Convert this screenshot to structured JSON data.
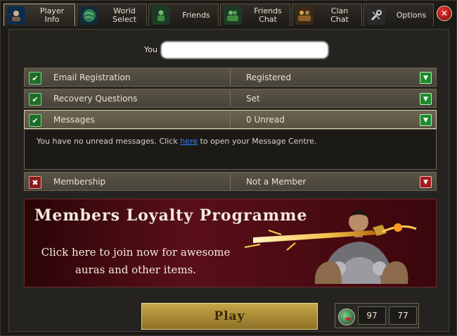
{
  "tabs": [
    {
      "label": "Player\nInfo",
      "icon": "player-icon"
    },
    {
      "label": "World\nSelect",
      "icon": "globe-icon"
    },
    {
      "label": "Friends",
      "icon": "friends-icon"
    },
    {
      "label": "Friends\nChat",
      "icon": "friends-chat-icon"
    },
    {
      "label": "Clan\nChat",
      "icon": "clan-icon"
    },
    {
      "label": "Options",
      "icon": "wrench-icon"
    }
  ],
  "you_label": "You",
  "rows": [
    {
      "name": "Email Registration",
      "value": "Registered",
      "status": "ok"
    },
    {
      "name": "Recovery Questions",
      "value": "Set",
      "status": "ok"
    },
    {
      "name": "Messages",
      "value": "0 Unread",
      "status": "ok"
    },
    {
      "name": "Membership",
      "value": "Not a Member",
      "status": "bad"
    }
  ],
  "message_info": {
    "prefix": "You have no unread messages. Click ",
    "link": "here",
    "suffix": " to open your Message Centre."
  },
  "banner": {
    "title": "Members Loyalty Programme",
    "line1": "Click here to join now for awesome",
    "line2": "auras and other items."
  },
  "play_label": "Play",
  "stats": {
    "a": "97",
    "b": "77"
  },
  "colors": {
    "accent_gold": "#c6a64a",
    "ok_green": "#1e6c2a",
    "bad_red": "#8b1c1c",
    "link_blue": "#3b7bff"
  }
}
